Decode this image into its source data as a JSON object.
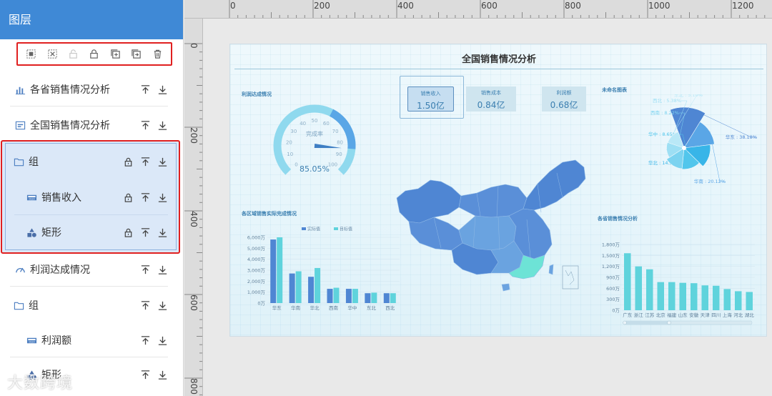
{
  "panel": {
    "title": "图层",
    "toolbar": [
      {
        "icon": "align-icon",
        "enabled": true
      },
      {
        "icon": "ungroup-icon",
        "enabled": true
      },
      {
        "icon": "unlock-icon",
        "enabled": false
      },
      {
        "icon": "lock-icon",
        "enabled": true
      },
      {
        "icon": "add-layer-icon",
        "enabled": true
      },
      {
        "icon": "copy-layer-icon",
        "enabled": true
      },
      {
        "icon": "trash-icon",
        "enabled": true
      }
    ],
    "layers": [
      {
        "label": "各省销售情况分析",
        "icon": "bar-chart-icon"
      },
      {
        "label": "全国销售情况分析",
        "icon": "title-icon"
      },
      {
        "label": "组",
        "icon": "folder-icon",
        "locked": true
      },
      {
        "label": "销售收入",
        "icon": "number-card-icon",
        "locked": true
      },
      {
        "label": "矩形",
        "icon": "shapes-icon",
        "locked": true
      },
      {
        "label": "利润达成情况",
        "icon": "gauge-icon"
      },
      {
        "label": "组",
        "icon": "folder-icon"
      },
      {
        "label": "利润额",
        "icon": "number-card-icon"
      },
      {
        "label": "矩形",
        "icon": "shapes-icon"
      }
    ],
    "watermark": "大数跨境"
  },
  "rulers": {
    "top": [
      "0",
      "200",
      "400",
      "600",
      "800",
      "1000",
      "1200"
    ],
    "left": [
      "0",
      "200",
      "400",
      "600",
      "800"
    ]
  },
  "dashboard": {
    "title": "全国销售情况分析",
    "gauge": {
      "title": "利润达成情况",
      "center_label": "完成率",
      "value_text": "85.05%",
      "value": 85.05,
      "ticks": [
        "0",
        "10",
        "20",
        "30",
        "40",
        "50",
        "60",
        "70",
        "80",
        "90",
        "100"
      ]
    },
    "kpis": [
      {
        "label": "销售收入",
        "value": "1.50亿"
      },
      {
        "label": "销售成本",
        "value": "0.84亿"
      },
      {
        "label": "利润额",
        "value": "0.68亿"
      }
    ],
    "pie_title": "未命名图表",
    "region_bar_title": "各区域销售实际完成情况",
    "province_bar_title": "各省销售情况分析",
    "colors": {
      "actual": "#4f86d3",
      "target": "#5fd3dc",
      "map_main": "#4f86d3",
      "map_alt": "#6aa3e0",
      "map_highlight": "#6de3d6"
    }
  },
  "chart_data": [
    {
      "type": "pie",
      "title": "未命名图表",
      "labels": [
        "华东",
        "华南",
        "华北",
        "华中",
        "西南",
        "西北",
        "东北"
      ],
      "values": [
        38.18,
        20.12,
        14.31,
        8.65,
        8.22,
        5.38,
        5.1
      ],
      "value_labels": [
        "华东 : 38.18%",
        "华南 : 20.12%",
        "华北 : 14.31%",
        "华中 : 8.65%",
        "西南 : 8.22%",
        "西北 : 5.38%",
        "东北 : 5.10%"
      ],
      "variant": "rose"
    },
    {
      "type": "bar",
      "title": "各区域销售实际完成情况",
      "categories": [
        "华东",
        "华南",
        "华北",
        "西南",
        "华中",
        "东北",
        "西北"
      ],
      "series": [
        {
          "name": "实际值",
          "values": [
            5800,
            2700,
            2400,
            1300,
            1300,
            900,
            900
          ]
        },
        {
          "name": "目标值",
          "values": [
            6000,
            2900,
            3200,
            1400,
            1300,
            950,
            900
          ]
        }
      ],
      "yticks": [
        "0万",
        "1,000万",
        "2,000万",
        "3,000万",
        "4,000万",
        "5,000万",
        "6,000万"
      ],
      "ylim": [
        0,
        6000
      ]
    },
    {
      "type": "bar",
      "title": "各省销售情况分析",
      "categories": [
        "广东",
        "浙江",
        "江苏",
        "北京",
        "福建",
        "山东",
        "安徽",
        "天津",
        "四川",
        "上海",
        "河北",
        "湖北"
      ],
      "values": [
        1560,
        1200,
        1120,
        770,
        770,
        750,
        740,
        680,
        670,
        580,
        520,
        500
      ],
      "yticks": [
        "0万",
        "300万",
        "600万",
        "900万",
        "1,200万",
        "1,500万",
        "1,800万"
      ],
      "ylim": [
        0,
        1800
      ]
    }
  ]
}
